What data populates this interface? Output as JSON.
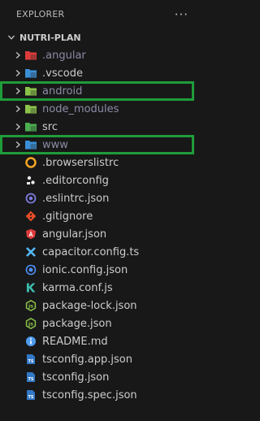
{
  "explorer": {
    "title": "EXPLORER",
    "more": "···"
  },
  "project": {
    "name": "NUTRI-PLAN"
  },
  "folders": [
    {
      "name": ".angular",
      "dimmed": true,
      "icon": "angular-folder-icon",
      "color": "#dd3b3b",
      "highlighted": false
    },
    {
      "name": ".vscode",
      "dimmed": false,
      "icon": "vscode-folder-icon",
      "color": "#3b8fd6",
      "highlighted": false
    },
    {
      "name": "android",
      "dimmed": true,
      "icon": "android-folder-icon",
      "color": "#8bc34a",
      "highlighted": true
    },
    {
      "name": "node_modules",
      "dimmed": true,
      "icon": "node-folder-icon",
      "color": "#8bc34a",
      "highlighted": false
    },
    {
      "name": "src",
      "dimmed": false,
      "icon": "src-folder-icon",
      "color": "#4caf50",
      "highlighted": false
    },
    {
      "name": "www",
      "dimmed": true,
      "icon": "www-folder-icon",
      "color": "#3b8fd6",
      "highlighted": true
    }
  ],
  "files": [
    {
      "name": ".browserslistrc",
      "icon": "browserslist-icon",
      "color": "#f4a623"
    },
    {
      "name": ".editorconfig",
      "icon": "editorconfig-icon",
      "color": "#e8e8e8"
    },
    {
      "name": ".eslintrc.json",
      "icon": "eslint-icon",
      "color": "#7b7bde"
    },
    {
      "name": ".gitignore",
      "icon": "git-icon",
      "color": "#e44d26"
    },
    {
      "name": "angular.json",
      "icon": "angular-icon",
      "color": "#dd3b3b"
    },
    {
      "name": "capacitor.config.ts",
      "icon": "capacitor-icon",
      "color": "#53b9ff"
    },
    {
      "name": "ionic.config.json",
      "icon": "ionic-icon",
      "color": "#4e8ef7"
    },
    {
      "name": "karma.conf.js",
      "icon": "karma-icon",
      "color": "#3cbeae"
    },
    {
      "name": "package-lock.json",
      "icon": "nodejs-icon",
      "color": "#8bc34a"
    },
    {
      "name": "package.json",
      "icon": "nodejs-icon",
      "color": "#8bc34a"
    },
    {
      "name": "README.md",
      "icon": "info-icon",
      "color": "#4e9cf0"
    },
    {
      "name": "tsconfig.app.json",
      "icon": "tsconfig-icon",
      "color": "#3178c6"
    },
    {
      "name": "tsconfig.json",
      "icon": "tsconfig-icon",
      "color": "#3178c6"
    },
    {
      "name": "tsconfig.spec.json",
      "icon": "tsconfig-icon",
      "color": "#3178c6"
    }
  ]
}
